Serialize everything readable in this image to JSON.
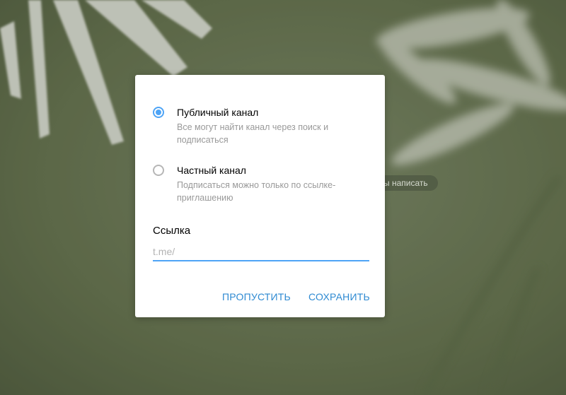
{
  "background": {
    "chip_text": "ы написать"
  },
  "dialog": {
    "options": [
      {
        "title": "Публичный канал",
        "description": "Все могут найти канал через поиск и подписаться",
        "checked": true
      },
      {
        "title": "Частный канал",
        "description": "Подписаться можно только по ссылке-приглашению",
        "checked": false
      }
    ],
    "link": {
      "label": "Ссылка",
      "placeholder": "t.me/",
      "value": ""
    },
    "buttons": {
      "skip": "ПРОПУСТИТЬ",
      "save": "СОХРАНИТЬ"
    }
  },
  "colors": {
    "accent": "#4ea4f6",
    "button_text": "#2e8ad2",
    "muted_text": "#999999"
  }
}
